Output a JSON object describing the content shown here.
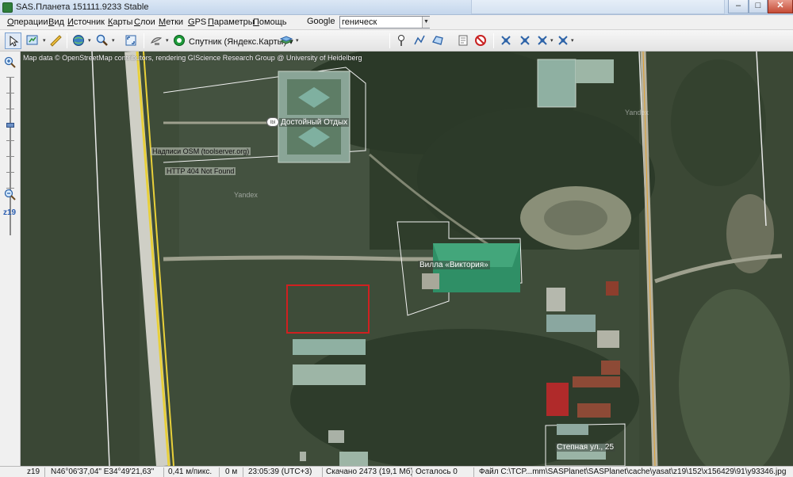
{
  "window": {
    "title": "SAS.Планета 151111.9233 Stable",
    "btn_min": "–",
    "btn_max": "□",
    "btn_close": "✕"
  },
  "menu": {
    "items": [
      {
        "u": "О",
        "rest": "перации"
      },
      {
        "u": "В",
        "rest": "ид"
      },
      {
        "u": "И",
        "rest": "сточник"
      },
      {
        "u": "К",
        "rest": "арты"
      },
      {
        "u": "С",
        "rest": "лои"
      },
      {
        "u": "М",
        "rest": "етки"
      },
      {
        "u": "G",
        "rest": "PS"
      },
      {
        "u": "П",
        "rest": "араметры"
      },
      {
        "u": "П",
        "rest": "омощь"
      }
    ],
    "geocoder": {
      "provider": "Google",
      "query": "геническ"
    }
  },
  "toolbar": {
    "map_type": "Спутник (Яндекс.Карты)"
  },
  "left_panel": {
    "zoom_label": "z19",
    "zoom_in": "+",
    "zoom_out": "–"
  },
  "map": {
    "attribution": "Map data © OpenStreetMap contributors, rendering GIScience Research Group @ University of Heidelberg",
    "labels": {
      "resort": "Достойный Отдых",
      "villa": "Вилла «Виктория»",
      "street": "Степная ул., 25",
      "osm_note": "Надписи OSM (toolserver.org)",
      "http_error": "HTTP 404 Not Found"
    },
    "watermarks": [
      "Yandex",
      "Yandex"
    ]
  },
  "status": {
    "zoom": "z19",
    "coords": "N46°06'37,04\" E34°49'21,63\"",
    "scale": "0,41 м/пикс.",
    "distance": "0 м",
    "time": "23:05:39 (UTC+3)",
    "downloaded": "Скачано 2473 (19,1 Мб)",
    "remaining": "Осталось 0",
    "file": "Файл C:\\TCP...mm\\SASPlanet\\SASPlanet\\cache\\yasat\\z19\\152\\x156429\\91\\y93346.jpg"
  }
}
